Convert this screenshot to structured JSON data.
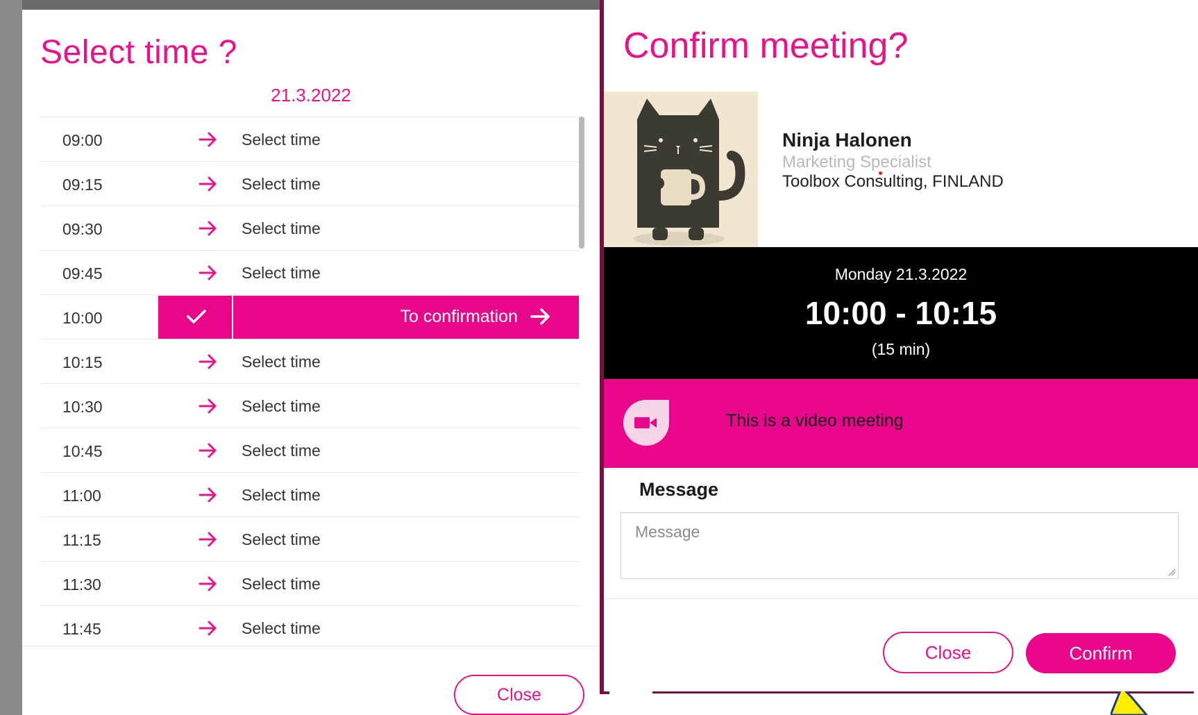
{
  "select_modal": {
    "title": "Select time ?",
    "date": "21.3.2022",
    "slots": [
      {
        "time": "09:00",
        "action": "Select time"
      },
      {
        "time": "09:15",
        "action": "Select time"
      },
      {
        "time": "09:30",
        "action": "Select time"
      },
      {
        "time": "09:45",
        "action": "Select time"
      },
      {
        "time": "10:00",
        "action": "To confirmation"
      },
      {
        "time": "10:15",
        "action": "Select time"
      },
      {
        "time": "10:30",
        "action": "Select time"
      },
      {
        "time": "10:45",
        "action": "Select time"
      },
      {
        "time": "11:00",
        "action": "Select time"
      },
      {
        "time": "11:15",
        "action": "Select time"
      },
      {
        "time": "11:30",
        "action": "Select time"
      },
      {
        "time": "11:45",
        "action": "Select time"
      }
    ],
    "close_label": "Close"
  },
  "confirm_modal": {
    "title": "Confirm meeting?",
    "person": {
      "name": "Ninja Halonen",
      "role": "Marketing Specialist",
      "company": "Toolbox Consulting, FINLAND"
    },
    "day_label": "Monday 21.3.2022",
    "time_range": "10:00 - 10:15",
    "duration": "(15 min)",
    "video_label": "This is a video meeting",
    "message_label": "Message",
    "message_placeholder": "Message",
    "close_label": "Close",
    "confirm_label": "Confirm"
  },
  "colors": {
    "accent": "#e8068a",
    "dark": "#000000"
  },
  "icons": {
    "slot_arrow": "arrow-right-icon",
    "selected_check": "check-icon",
    "video": "video-camera-icon"
  }
}
